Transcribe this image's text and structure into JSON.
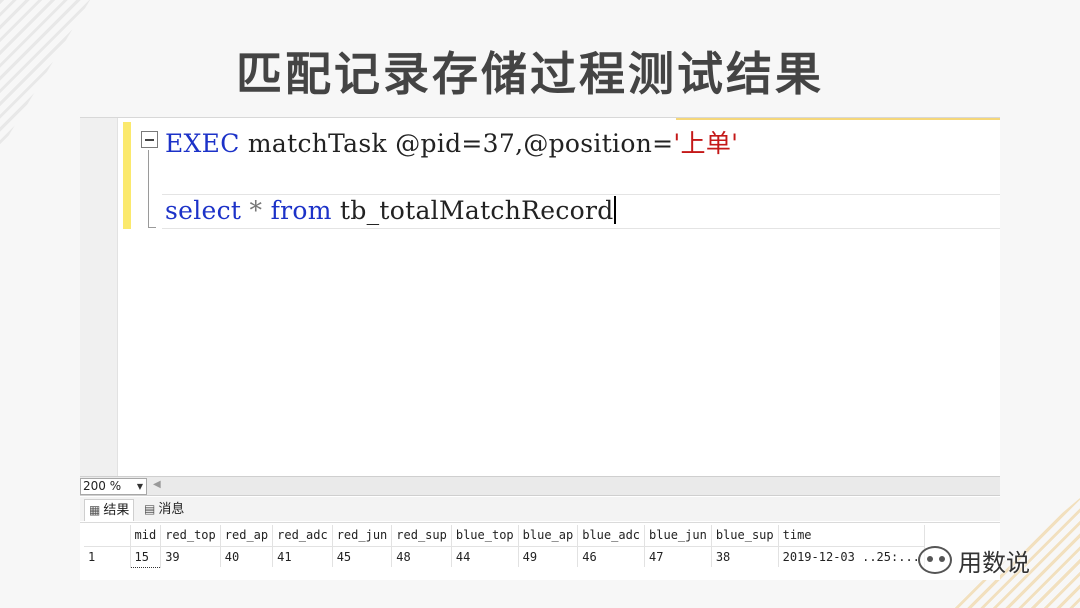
{
  "slide": {
    "title": "匹配记录存储过程测试结果"
  },
  "editor": {
    "line1": {
      "keyword": "EXEC",
      "name": " matchTask @pid=37,@position=",
      "string": "'上单'"
    },
    "line3": {
      "kw_select": "select",
      "star": " * ",
      "kw_from": "from",
      "table": " tb_totalMatchRecord"
    },
    "colors": {
      "keyword": "#1c32c8",
      "string": "#c41818",
      "change_bar": "#fbe96d"
    }
  },
  "zoom": {
    "value": "200 %"
  },
  "tabs": {
    "results_label": "结果",
    "messages_label": "消息"
  },
  "grid": {
    "columns": [
      "mid",
      "red_top",
      "red_ap",
      "red_adc",
      "red_jun",
      "red_sup",
      "blue_top",
      "blue_ap",
      "blue_adc",
      "blue_jun",
      "blue_sup",
      "time"
    ],
    "rows": [
      {
        "rownum": "1",
        "cells": [
          "15",
          "39",
          "40",
          "41",
          "45",
          "48",
          "44",
          "49",
          "46",
          "47",
          "38",
          "2019-12-03 ..25:..."
        ]
      }
    ]
  },
  "watermark": {
    "text": "用数说",
    "icon": "wechat-icon"
  }
}
